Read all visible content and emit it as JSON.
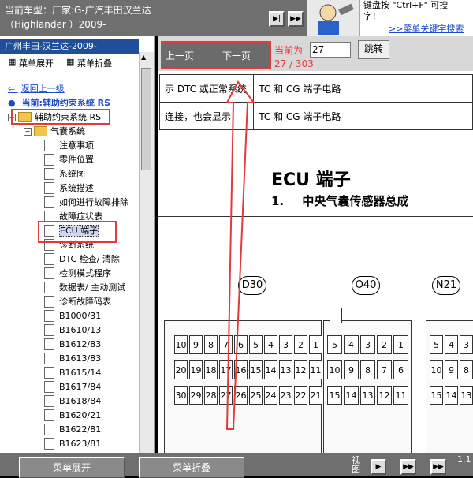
{
  "header": {
    "line1": "当前车型：厂家:G-广汽丰田汉兰达",
    "line2": "（Highlander ）2009-",
    "hint_line1": "键盘按 \"Ctrl+F\" 可搜",
    "hint_line2": "字！",
    "hint_link": ">>菜单关键字搜索"
  },
  "sidebar": {
    "title": "广州丰田-汉兰达-2009-",
    "expand_label": "菜单展开",
    "collapse_label": "菜单折叠",
    "back_label": "返回上一级",
    "current_label": "当前:辅助约束系统 RS",
    "root_label": "辅助约束系统 RS",
    "folder_label": "气囊系统",
    "items": [
      "注意事项",
      "零件位置",
      "系统图",
      "系统描述",
      "如何进行故障排除",
      "故障症状表",
      "ECU 端子",
      "诊断系统",
      "DTC 检查/ 清除",
      "检测模式程序",
      "数据表/ 主动测试",
      "诊断故障码表",
      "B1000/31",
      "B1610/13",
      "B1612/83",
      "B1613/83",
      "B1615/14",
      "B1617/84",
      "B1618/84",
      "B1620/21",
      "B1622/81",
      "B1623/81"
    ]
  },
  "pager": {
    "prev_label": "上一页",
    "next_label": "下一页",
    "current_label": "当前为",
    "page_value": "27",
    "count_label": "27 / 303",
    "go_label": "跳转"
  },
  "content": {
    "rows": [
      {
        "left": "示 DTC 或正常系统",
        "right": "TC 和 CG 端子电路"
      },
      {
        "left": "连接，也会显示",
        "right": "TC 和 CG 端子电路"
      }
    ],
    "title": "ECU 端子",
    "subtitle_num": "1.",
    "subtitle": "中央气囊传感器总成",
    "connectors": [
      "D30",
      "O40",
      "N21"
    ],
    "pins_a": {
      "row1": [
        "10",
        "9",
        "8",
        "7",
        "6",
        "5",
        "4",
        "3",
        "2",
        "1"
      ],
      "row2": [
        "20",
        "19",
        "18",
        "17",
        "16",
        "15",
        "14",
        "13",
        "12",
        "11"
      ],
      "row3": [
        "30",
        "29",
        "28",
        "27",
        "26",
        "25",
        "24",
        "23",
        "22",
        "21"
      ]
    },
    "pins_b": {
      "row1": [
        "5",
        "4",
        "3",
        "2",
        "1"
      ],
      "row2": [
        "10",
        "9",
        "8",
        "7",
        "6"
      ],
      "row3": [
        "15",
        "14",
        "13",
        "12",
        "11"
      ]
    },
    "pins_c": {
      "row1": [
        "5",
        "4",
        "3"
      ],
      "row2": [
        "10",
        "9",
        "8"
      ],
      "row3": [
        "15",
        "14",
        "13"
      ]
    }
  },
  "footer": {
    "expand_label": "菜单展开",
    "collapse_label": "菜单折叠",
    "view_label": "视图",
    "version": "1.1"
  }
}
